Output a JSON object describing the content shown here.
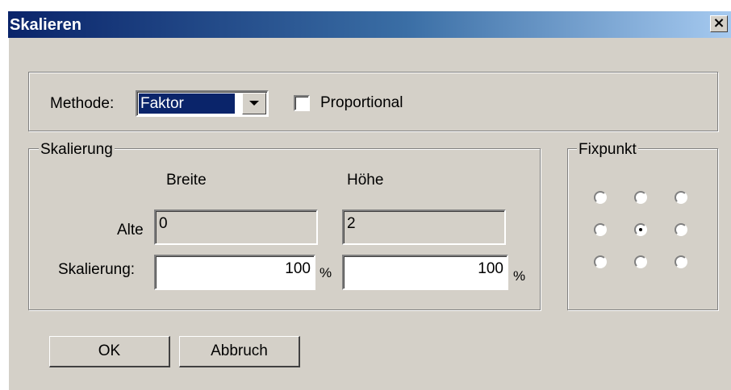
{
  "window": {
    "title": "Skalieren"
  },
  "top": {
    "method_label": "Methode:",
    "method_value": "Faktor",
    "proportional_label": "Proportional",
    "proportional_checked": false
  },
  "scaling": {
    "legend": "Skalierung",
    "width_header": "Breite",
    "height_header": "Höhe",
    "old_label": "Alte",
    "old_width": "0",
    "old_height": "2",
    "scale_label": "Skalierung:",
    "scale_width": "100",
    "scale_height": "100",
    "unit": "%"
  },
  "fixpoint": {
    "legend": "Fixpunkt",
    "selected": "center"
  },
  "buttons": {
    "ok": "OK",
    "cancel": "Abbruch"
  }
}
